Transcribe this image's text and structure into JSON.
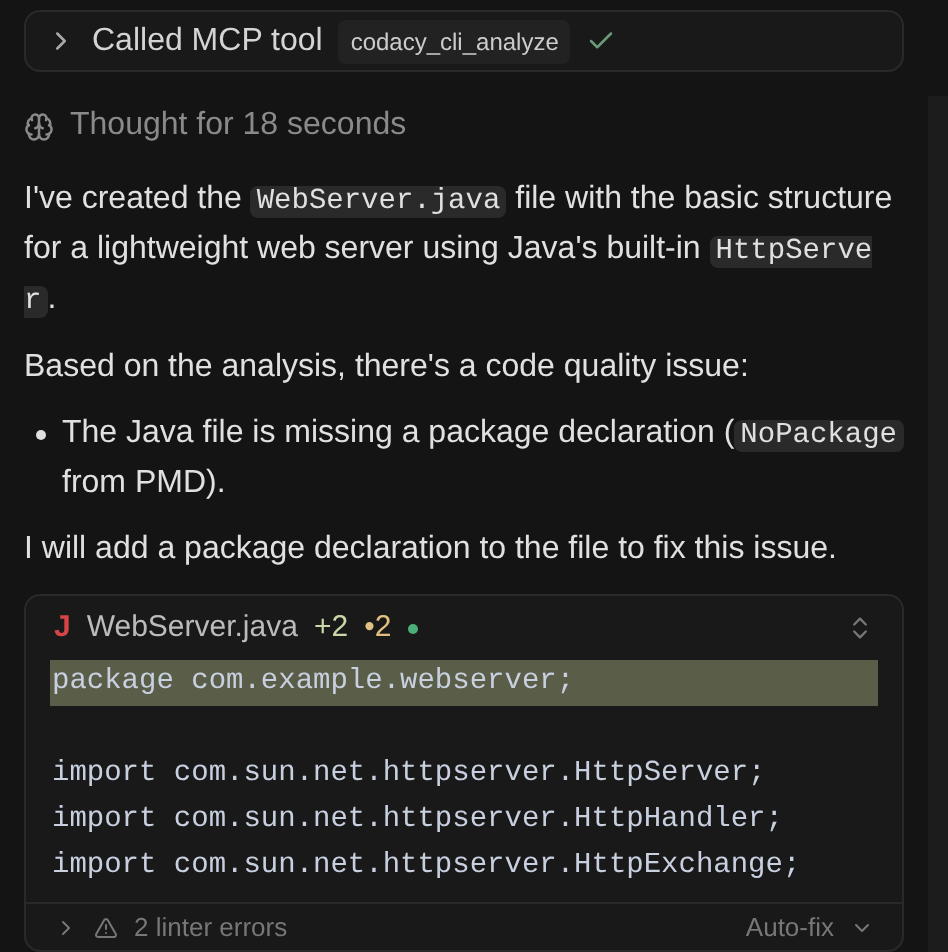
{
  "tool_call": {
    "label": "Called MCP tool",
    "tool": "codacy_cli_analyze",
    "done": true
  },
  "thought": "Thought for 18 seconds",
  "paragraphs": [
    {
      "kind": "para",
      "segments": [
        {
          "kind": "text",
          "text": "I've created the "
        },
        {
          "kind": "code",
          "text": "WebServer.java"
        },
        {
          "kind": "text",
          "text": " file with the basic structure for a lightweight web server using Java's built-in "
        },
        {
          "kind": "code",
          "text": "HttpServer"
        },
        {
          "kind": "text",
          "text": "."
        }
      ]
    },
    {
      "kind": "para",
      "segments": [
        {
          "kind": "text",
          "text": "Based on the analysis, there's a code quality issue:"
        }
      ]
    },
    {
      "kind": "bullet",
      "segments": [
        {
          "kind": "text",
          "text": "The Java file is missing a package declaration ("
        },
        {
          "kind": "code",
          "text": "NoPackage"
        },
        {
          "kind": "text",
          "text": " from PMD)."
        }
      ]
    },
    {
      "kind": "para",
      "segments": [
        {
          "kind": "text",
          "text": "I will add a package declaration to the file to fix this issue."
        }
      ]
    }
  ],
  "code_card": {
    "file_icon": "J",
    "filename": "WebServer.java",
    "added": "+2",
    "changed": "•2",
    "lines": [
      {
        "text": "package com.example.webserver;",
        "added": true
      },
      {
        "text": "import com.sun.net.httpserver.HttpServer;",
        "added": false,
        "gap_before": true
      },
      {
        "text": "import com.sun.net.httpserver.HttpHandler;",
        "added": false
      },
      {
        "text": "import com.sun.net.httpserver.HttpExchange;",
        "added": false
      }
    ],
    "linter": "2 linter errors",
    "autofix": "Auto-fix"
  }
}
